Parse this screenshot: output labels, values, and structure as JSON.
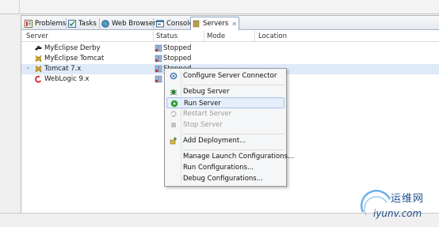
{
  "tabs": [
    {
      "label": "Problems",
      "icon": "problems-icon"
    },
    {
      "label": "Tasks",
      "icon": "tasks-icon"
    },
    {
      "label": "Web Browser",
      "icon": "web-browser-icon"
    },
    {
      "label": "Console",
      "icon": "console-icon"
    },
    {
      "label": "Servers",
      "icon": "servers-icon",
      "active": true,
      "close": "✕"
    }
  ],
  "columns": [
    "Server",
    "Status",
    "Mode",
    "Location"
  ],
  "servers": [
    {
      "name": "MyEclipse Derby",
      "status": "Stopped",
      "icon": "derby-icon"
    },
    {
      "name": "MyEclipse Tomcat",
      "status": "Stopped",
      "icon": "tomcat-icon"
    },
    {
      "name": "Tomcat  7.x",
      "status": "Stopped",
      "icon": "tomcat-icon",
      "selected": true,
      "expander": "»"
    },
    {
      "name": "WebLogic  9.x",
      "status": "Stopped",
      "icon": "weblogic-icon"
    }
  ],
  "context_menu": {
    "items": [
      {
        "label": "Configure Server Connector",
        "icon": "configure-icon",
        "enabled": true
      },
      {
        "label": "Debug Server",
        "icon": "debug-icon",
        "enabled": true
      },
      {
        "label": "Run Server",
        "icon": "run-icon",
        "enabled": true,
        "hover": true
      },
      {
        "label": "Restart Server",
        "icon": "restart-icon",
        "enabled": false
      },
      {
        "label": "Stop Server",
        "icon": "stop-icon",
        "enabled": false
      },
      {
        "label": "Add Deployment...",
        "icon": "add-deployment-icon",
        "enabled": true
      },
      {
        "label": "Manage Launch Configurations...",
        "enabled": true
      },
      {
        "label": "Run Configurations...",
        "enabled": true
      },
      {
        "label": "Debug Configurations...",
        "enabled": true
      }
    ]
  },
  "watermark": {
    "title": "运维网",
    "url": "iyunv.com"
  },
  "colors": {
    "accent": "#1f4f8f",
    "selection": "#dfeaf8",
    "run_green": "#2e9e2e"
  }
}
